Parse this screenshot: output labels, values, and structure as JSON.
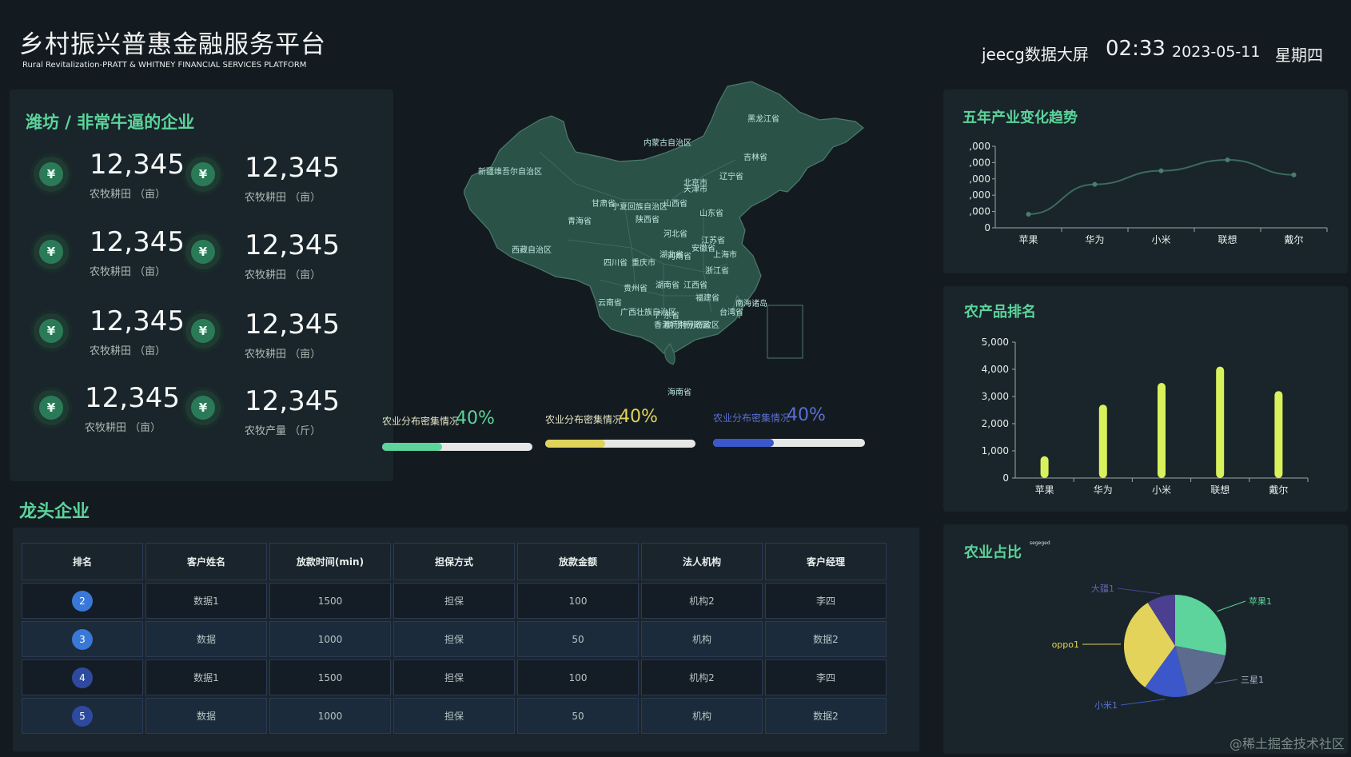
{
  "header": {
    "title": "乡村振兴普惠金融服务平台",
    "subtitle": "Rural Revitalization-PRATT & WHITNEY FINANCIAL SERVICES PLATFORM",
    "screen_name": "jeecg数据大屏",
    "time": "02:33",
    "date": "2023-05-11",
    "weekday": "星期四"
  },
  "left_panel": {
    "title": "潍坊 / 非常牛逼的企业",
    "stats": [
      {
        "value": "12,345",
        "label": "农牧耕田 （亩）"
      },
      {
        "value": "12,345",
        "label": "农牧耕田 （亩）"
      },
      {
        "value": "12,345",
        "label": "农牧耕田 （亩）"
      },
      {
        "value": "12,345",
        "label": "农牧耕田 （亩）"
      },
      {
        "value": "12,345",
        "label": "农牧耕田 （亩）"
      },
      {
        "value": "12,345",
        "label": "农牧耕田 （亩）"
      },
      {
        "value": "12,345",
        "label": "农牧耕田 （亩）"
      },
      {
        "value": "12,345",
        "label": "农牧产量 （斤）"
      }
    ],
    "icon": "coin-icon"
  },
  "map": {
    "provinces": [
      "黑龙江省",
      "内蒙古自治区",
      "吉林省",
      "新疆维吾尔自治区",
      "辽宁省",
      "北京市",
      "天津市",
      "甘肃省",
      "宁夏回族自治区",
      "山西省",
      "青海省",
      "陕西省",
      "山东省",
      "河北省",
      "西藏自治区",
      "河南省",
      "江苏省",
      "安徽省",
      "上海市",
      "湖北省",
      "四川省",
      "重庆市",
      "浙江省",
      "湖南省",
      "江西省",
      "贵州省",
      "福建省",
      "云南省",
      "广西壮族自治区",
      "台湾省",
      "广东省",
      "香港特别行政区",
      "澳门特别行政区",
      "海南省",
      "南海诸岛"
    ]
  },
  "progress": [
    {
      "label": "农业分布密集情况",
      "value": "40%",
      "percent": 40,
      "color": "#5cd49b"
    },
    {
      "label": "农业分布密集情况",
      "value": "40%",
      "percent": 40,
      "color": "#e0d35b"
    },
    {
      "label": "农业分布密集情况",
      "value": "40%",
      "percent": 40,
      "color": "#3b57c9"
    }
  ],
  "right_panels": {
    "trend_title": "五年产业变化趋势",
    "rank_title": "农产品排名",
    "pie_title": "农业占比",
    "pie_small_label": "segeged"
  },
  "chart_data": [
    {
      "type": "line",
      "title": "五年产业变化趋势",
      "categories": [
        "苹果",
        "华为",
        "小米",
        "联想",
        "戴尔"
      ],
      "y_tick_labels": [
        ",000",
        ",000",
        ",000",
        ",000",
        ",000",
        "0"
      ],
      "values": [
        1000,
        3200,
        4200,
        5000,
        3900
      ],
      "ylim": [
        0,
        6000
      ],
      "grid": false
    },
    {
      "type": "bar",
      "title": "农产品排名",
      "categories": [
        "苹果",
        "华为",
        "小米",
        "联想",
        "戴尔"
      ],
      "values": [
        800,
        2700,
        3500,
        4100,
        3200
      ],
      "ylim": [
        0,
        5000
      ],
      "y_ticks": [
        "0",
        "1,000",
        "2,000",
        "3,000",
        "4,000",
        "5,000"
      ],
      "grid": false
    },
    {
      "type": "pie",
      "title": "农业占比",
      "series": [
        {
          "name": "苹果1",
          "value": 28,
          "color": "#5cd49b"
        },
        {
          "name": "三星1",
          "value": 18,
          "color": "#5c6b8e"
        },
        {
          "name": "小米1",
          "value": 14,
          "color": "#3b57c9"
        },
        {
          "name": "oppo1",
          "value": 31,
          "color": "#e3d35a"
        },
        {
          "name": "大疆1",
          "value": 9,
          "color": "#4a3f91"
        }
      ]
    }
  ],
  "leaders": {
    "title": "龙头企业",
    "columns": [
      "排名",
      "客户姓名",
      "放款时间(min)",
      "担保方式",
      "放款金额",
      "法人机构",
      "客户经理"
    ],
    "rows": [
      {
        "rank": "2",
        "rank_color": "#3a78d8",
        "cells": [
          "数据1",
          "1500",
          "担保",
          "100",
          "机构2",
          "李四"
        ]
      },
      {
        "rank": "3",
        "rank_color": "#3a78d8",
        "cells": [
          "数据",
          "1000",
          "担保",
          "50",
          "机构",
          "数据2"
        ]
      },
      {
        "rank": "4",
        "rank_color": "#2e4a9e",
        "cells": [
          "数据1",
          "1500",
          "担保",
          "100",
          "机构2",
          "李四"
        ]
      },
      {
        "rank": "5",
        "rank_color": "#2e4a9e",
        "cells": [
          "数据",
          "1000",
          "担保",
          "50",
          "机构",
          "数据2"
        ]
      }
    ]
  },
  "watermark": "@稀土掘金技术社区"
}
